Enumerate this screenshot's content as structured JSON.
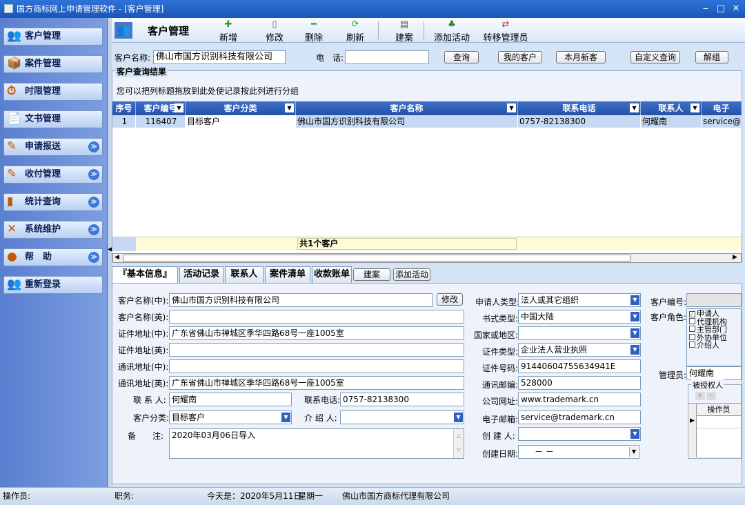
{
  "window": {
    "title": "国方商标网上申请管理软件 - [客户管理]",
    "min": "‒",
    "max": "□",
    "close": "✕"
  },
  "sidebar": {
    "items": [
      {
        "label": "客户管理",
        "icon": "👥",
        "expand": false
      },
      {
        "label": "案件管理",
        "icon": "📦",
        "expand": false
      },
      {
        "label": "时限管理",
        "icon": "⏱",
        "expand": false
      },
      {
        "label": "文书管理",
        "icon": "📄",
        "expand": false
      },
      {
        "label": "申请报送",
        "icon": "✎",
        "expand": true
      },
      {
        "label": "收付管理",
        "icon": "✎",
        "expand": true
      },
      {
        "label": "统计查询",
        "icon": "▮",
        "expand": true
      },
      {
        "label": "系统维护",
        "icon": "✕",
        "expand": true
      },
      {
        "label": "帮　助",
        "icon": "●",
        "expand": true
      },
      {
        "label": "重新登录",
        "icon": "👥",
        "expand": false
      }
    ],
    "chevron": "≫"
  },
  "toolbar": {
    "title": "客户管理",
    "buttons": [
      {
        "label": "新增",
        "icon": "✚",
        "color": "#2f9a2f"
      },
      {
        "label": "修改",
        "icon": "▯",
        "color": "#666666"
      },
      {
        "label": "删除",
        "icon": "━",
        "color": "#2f9a2f"
      },
      {
        "label": "刷新",
        "icon": "⟳",
        "color": "#2f9a2f"
      },
      {
        "label": "建案",
        "icon": "▤",
        "color": "#555555"
      },
      {
        "label": "添加活动",
        "icon": "♣",
        "color": "#2f7a2f"
      },
      {
        "label": "转移管理员",
        "icon": "⇄",
        "color": "#c03030"
      }
    ]
  },
  "search": {
    "name_label": "客户名称:",
    "name_value": "佛山市国方识别科技有限公司",
    "phone_label": "电　话:",
    "phone_value": "",
    "buttons": [
      "查询",
      "我的客户",
      "本月新客",
      "自定义查询",
      "解组"
    ]
  },
  "results": {
    "legend": "客户查询结果",
    "group_hint": "您可以把列标题拖放到此处使记录按此列进行分组",
    "columns": [
      "序号",
      "客户编号",
      "客户分类",
      "客户名称",
      "联系电话",
      "联系人",
      "电子"
    ],
    "rows": [
      [
        "1",
        "116407",
        "目标客户",
        "佛山市国方识别科技有限公司",
        "0757-82138300",
        "何耀南",
        "service@t"
      ]
    ],
    "footer": "共1个客户"
  },
  "tabs": {
    "items": [
      "『基本信息』",
      "活动记录",
      "联系人",
      "案件清单",
      "收款账单"
    ],
    "btn_case": "建案",
    "btn_activity": "添加活动"
  },
  "detail": {
    "name_cn_label": "客户名称(中):",
    "name_cn": "佛山市国方识别科技有限公司",
    "modify_btn": "修改",
    "name_en_label": "客户名称(英):",
    "name_en": "",
    "cert_addr_cn_label": "证件地址(中):",
    "cert_addr_cn": "广东省佛山市禅城区季华四路68号一座1005室",
    "cert_addr_en_label": "证件地址(英):",
    "cert_addr_en": "",
    "mail_addr_cn_label": "通讯地址(中):",
    "mail_addr_cn": "",
    "mail_addr_en_label": "通讯地址(英):",
    "mail_addr_en": "广东省佛山市禅城区季华四路68号一座1005室",
    "contact_label": "联 系 人:",
    "contact": "何耀南",
    "phone_label": "联系电话:",
    "phone": "0757-82138300",
    "category_label": "客户分类:",
    "category": "目标客户",
    "referrer_label": "介 绍 人:",
    "referrer": "",
    "remark_label": "备　　注:",
    "remark": "2020年03月06日导入",
    "applicant_type_label": "申请人类型:",
    "applicant_type": "法人或其它组织",
    "format_label": "书式类型:",
    "format": "中国大陆",
    "country_label": "国家或地区:",
    "country": "",
    "cert_type_label": "证件类型:",
    "cert_type": "企业法人营业执照",
    "cert_no_label": "证件号码:",
    "cert_no": "91440604755634941E",
    "postcode_label": "通讯邮编:",
    "postcode": "528000",
    "website_label": "公司网址:",
    "website": "www.trademark.cn",
    "email_label": "电子邮箱:",
    "email": "service@trademark.cn",
    "creator_label": "创 建 人:",
    "creator": "",
    "created_label": "创建日期:",
    "created": "－ －",
    "custno_label": "客户编号:",
    "custno": "",
    "roles_label": "客户角色:",
    "roles": [
      {
        "label": "申请人",
        "checked": true
      },
      {
        "label": "代理机构",
        "checked": false
      },
      {
        "label": "主管部门",
        "checked": false
      },
      {
        "label": "外协单位",
        "checked": false
      },
      {
        "label": "介绍人",
        "checked": false
      }
    ],
    "manager_label": "管理员:",
    "manager": "何耀南",
    "authorized_label": "被授权人",
    "operator_col": "操作员"
  },
  "status": {
    "operator": "操作员:",
    "position": "职务:",
    "today": "今天是：2020年5月11日",
    "weekday": "星期一",
    "company": "佛山市国方商标代理有限公司"
  }
}
